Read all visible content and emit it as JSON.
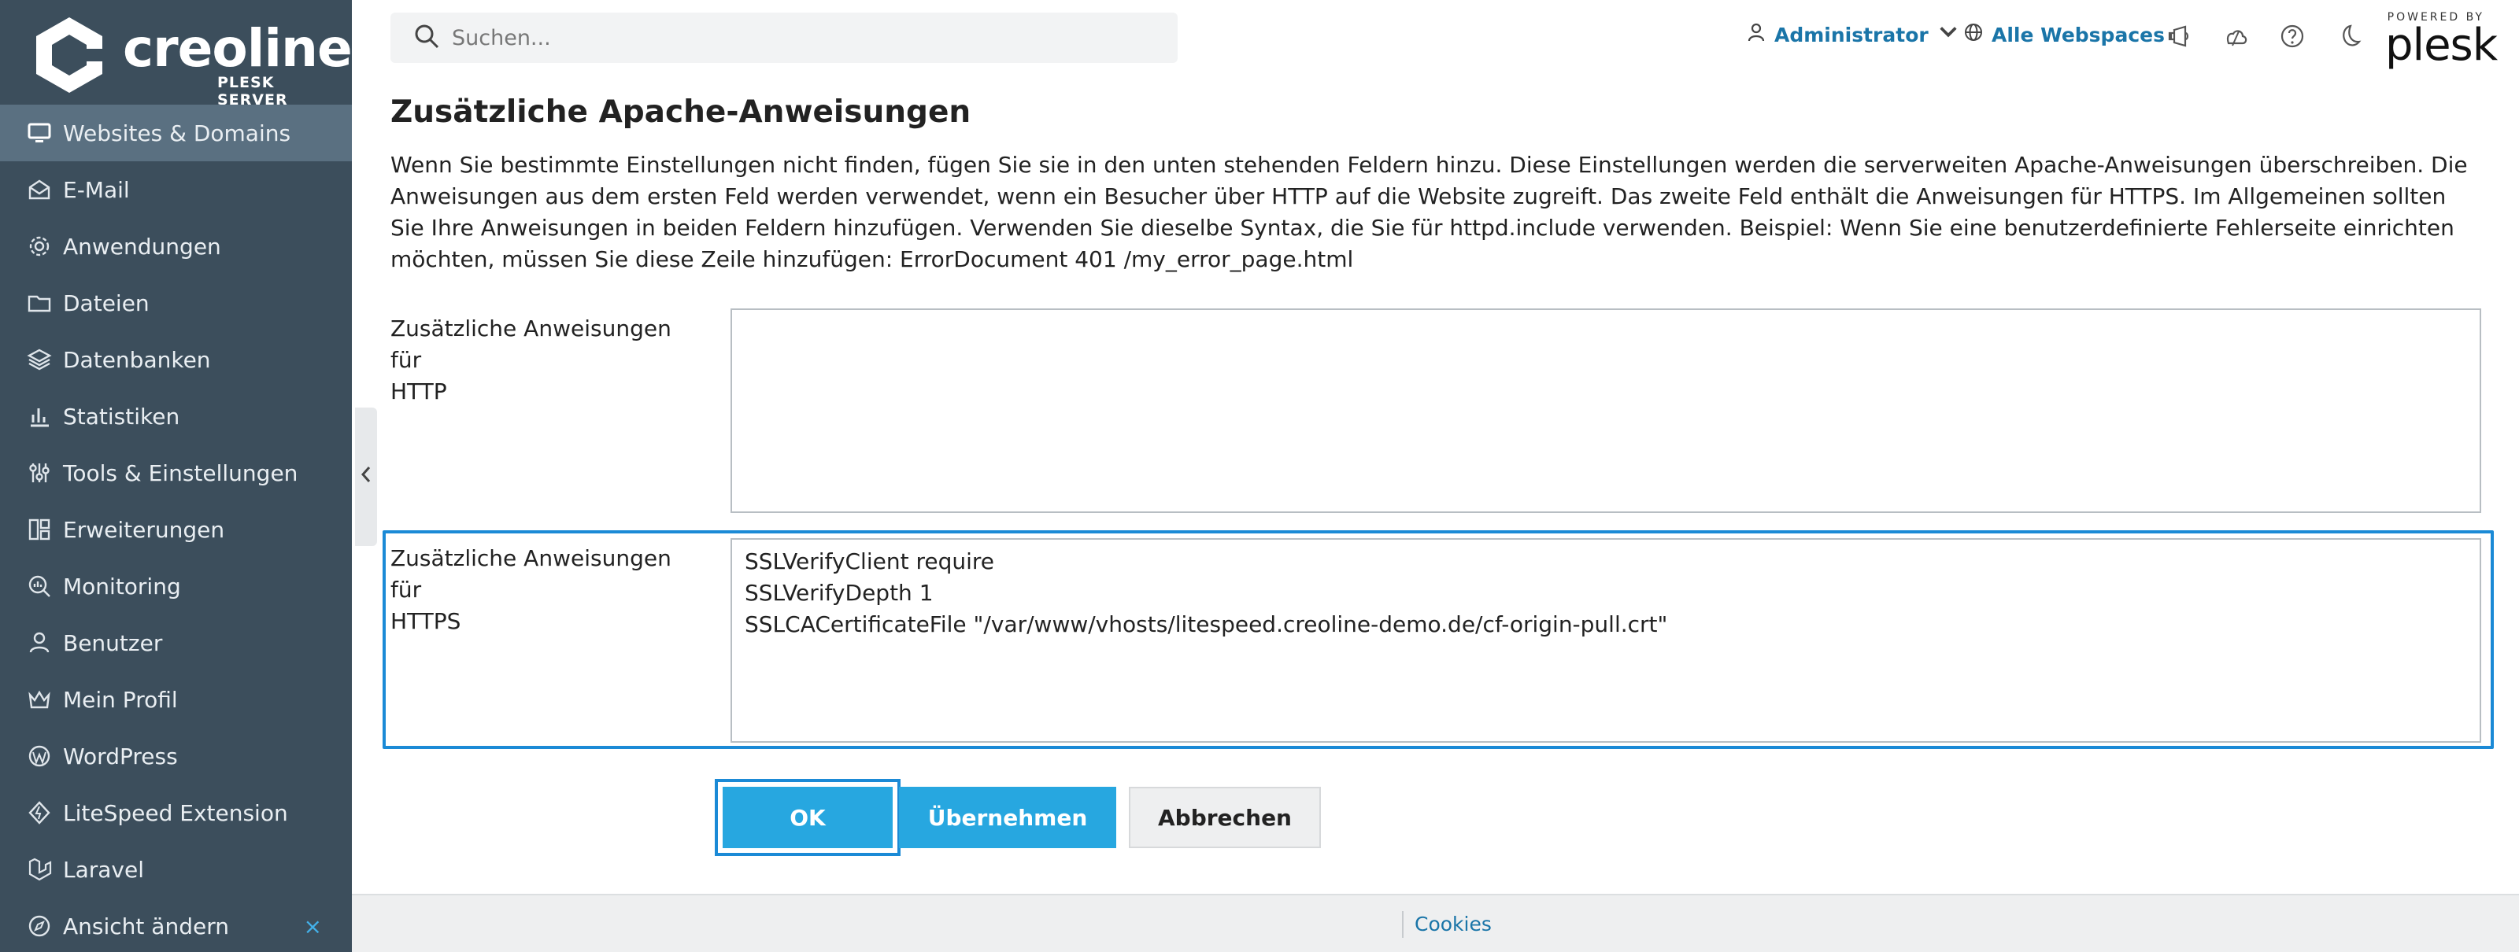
{
  "brand": {
    "name": "creoline",
    "sub": "PLESK SERVER",
    "powered_by": "POWERED BY",
    "plesk": "plesk"
  },
  "sidebar": {
    "items": [
      {
        "label": "Websites & Domains",
        "icon": "monitor-icon",
        "active": true
      },
      {
        "label": "E-Mail",
        "icon": "envelope-icon"
      },
      {
        "label": "Anwendungen",
        "icon": "gear-icon"
      },
      {
        "label": "Dateien",
        "icon": "folder-icon"
      },
      {
        "label": "Datenbanken",
        "icon": "layers-icon"
      },
      {
        "label": "Statistiken",
        "icon": "bar-chart-icon"
      },
      {
        "label": "Tools & Einstellungen",
        "icon": "sliders-icon"
      },
      {
        "label": "Erweiterungen",
        "icon": "blocks-icon"
      },
      {
        "label": "Monitoring",
        "icon": "magnifier-chart-icon"
      },
      {
        "label": "Benutzer",
        "icon": "user-icon"
      },
      {
        "label": "Mein Profil",
        "icon": "crown-icon"
      },
      {
        "label": "WordPress",
        "icon": "wordpress-icon"
      },
      {
        "label": "LiteSpeed Extension",
        "icon": "diamond-icon"
      },
      {
        "label": "Laravel",
        "icon": "laravel-icon"
      },
      {
        "label": "Ansicht ändern",
        "icon": "compass-icon"
      }
    ],
    "close_glyph": "×"
  },
  "header": {
    "search_placeholder": "Suchen...",
    "user_label": "Administrator",
    "webspaces_label": "Alle Webspaces"
  },
  "main": {
    "title": "Zusätzliche Apache-Anweisungen",
    "description": "Wenn Sie bestimmte Einstellungen nicht finden, fügen Sie sie in den unten stehenden Feldern hinzu. Diese Einstellungen werden die serverweiten Apache-Anweisungen überschreiben. Die Anweisungen aus dem ersten Feld werden verwendet, wenn ein Besucher über HTTP auf die Website zugreift. Das zweite Feld enthält die Anweisungen für HTTPS. Im Allgemeinen sollten Sie Ihre Anweisungen in beiden Feldern hinzufügen. Verwenden Sie dieselbe Syntax, die Sie für httpd.include verwenden. Beispiel: Wenn Sie eine benutzerdefinierte Fehlerseite einrichten möchten, müssen Sie diese Zeile hinzufügen: ErrorDocument 401 /my_error_page.html",
    "http_label_1": "Zusätzliche Anweisungen für",
    "http_label_2": "HTTP",
    "http_value": "",
    "https_label_1": "Zusätzliche Anweisungen für",
    "https_label_2": "HTTPS",
    "https_lines": [
      "SSLVerifyClient require",
      "SSLVerifyDepth 1",
      "SSLCACertificateFile \"/var/www/vhosts/litespeed.creoline-demo.de/cf-origin-pull.crt\""
    ]
  },
  "buttons": {
    "ok": "OK",
    "apply": "Übernehmen",
    "cancel": "Abbrechen"
  },
  "footer": {
    "cookies": "Cookies"
  },
  "colors": {
    "sidebar_bg": "#3c4e5c",
    "sidebar_active": "#5a7081",
    "accent": "#27a7e0",
    "focus": "#1b8ad6",
    "link": "#1a75a8"
  }
}
